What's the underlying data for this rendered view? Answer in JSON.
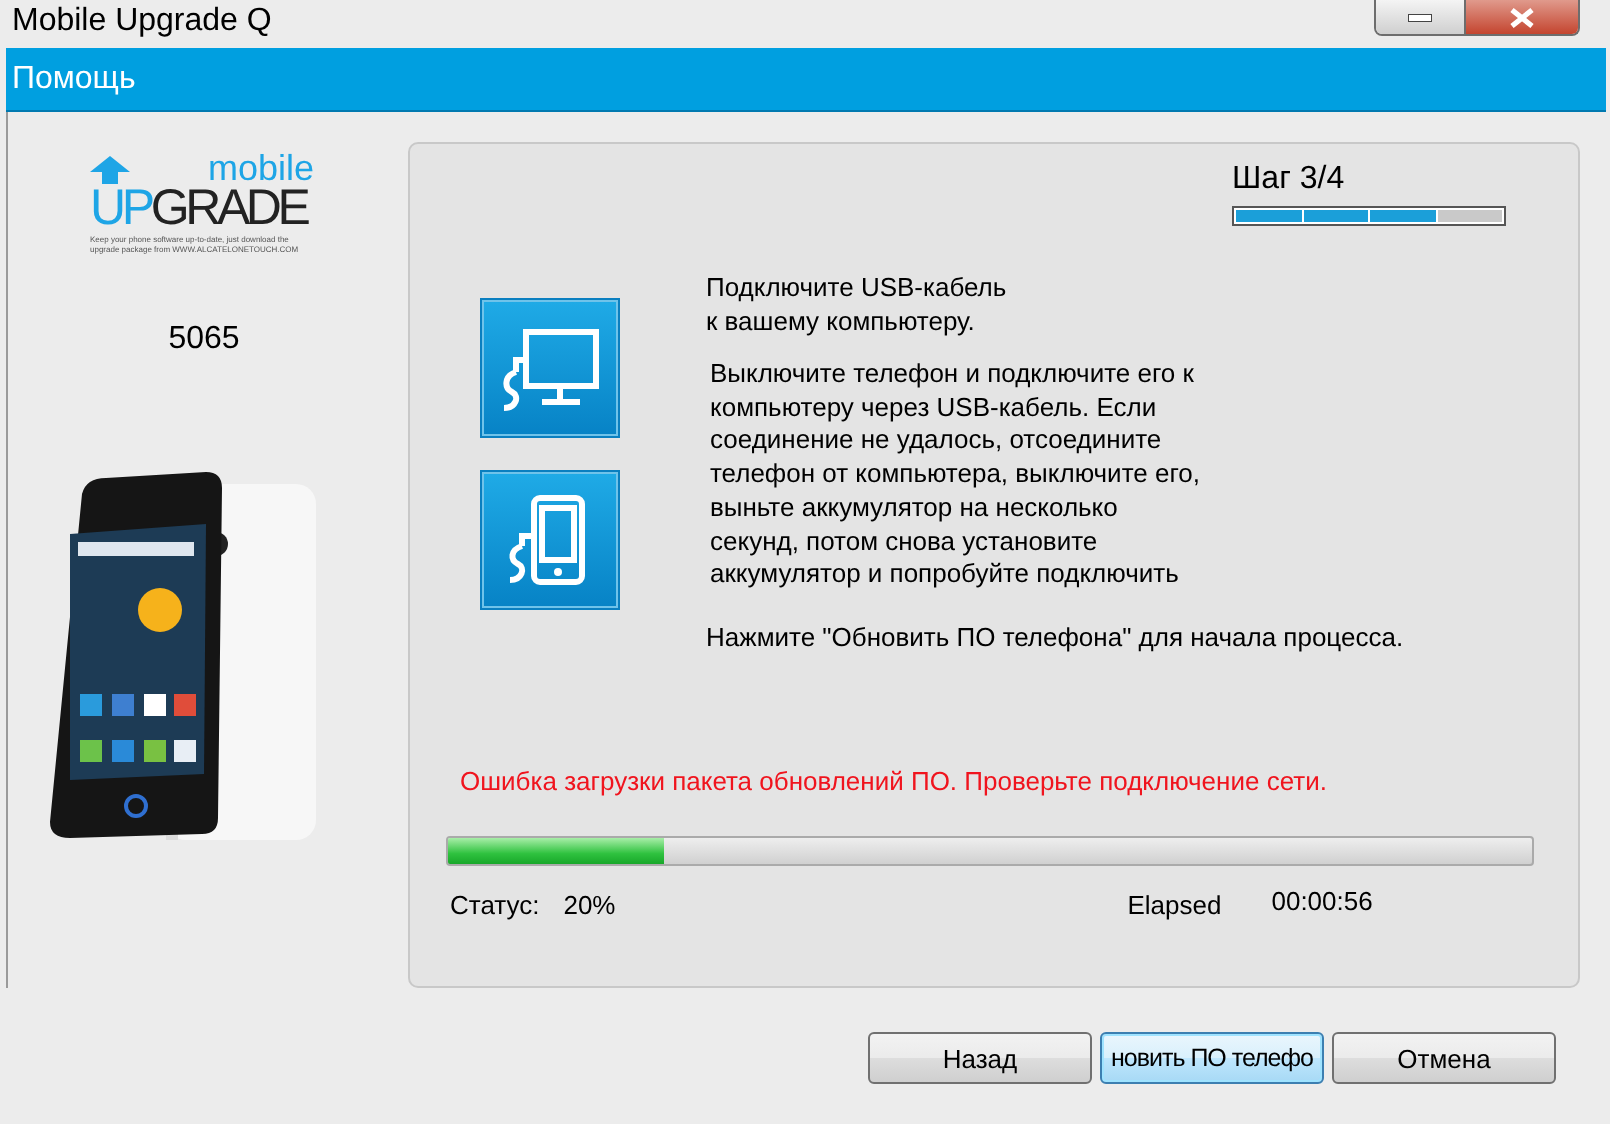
{
  "window": {
    "title": "Mobile Upgrade Q",
    "controls": [
      {
        "kind": "minimize"
      },
      {
        "kind": "close"
      }
    ]
  },
  "menu": [
    "Помощь"
  ],
  "sidebar": {
    "logo": {
      "small": "mobile",
      "up": "UP",
      "grade": "GRADE",
      "tagline": "Keep your phone software up-to-date, just download the upgrade package from WWW.ALCATELONETOUCH.COM"
    },
    "model": "5065"
  },
  "step": {
    "label": "Шаг 3/4",
    "segments": [
      {
        "filled": true
      },
      {
        "filled": true
      },
      {
        "filled": true
      },
      {
        "filled": false
      }
    ]
  },
  "icons": [
    {
      "kind": "monitor"
    },
    {
      "kind": "phone"
    }
  ],
  "instructions": [
    "Подключите USB-кабель\nк вашему компьютеру.",
    "Выключите телефон и  подключите его к\nкомпьютеру через  USB-кабель. Если\nсоединение  не удалось, отсоедините\nтелефон от компьютера, выключите его,\nвыньте  аккумулятор на несколько\nсекунд,  потом снова установите\nаккумулятор  и попробуйте подключить",
    "Нажмите \"Обновить ПО телефона\" для начала процесса."
  ],
  "error": "Ошибка загрузки пакета обновлений ПО. Проверьте подключение сети.",
  "progress": {
    "level": 0.2,
    "status_label": "Статус:",
    "status_value": "20%",
    "elapsed_label": "Elapsed",
    "elapsed_value": "00:00:56"
  },
  "buttons": [
    {
      "label": "Назад",
      "focused": false
    },
    {
      "label": "новить ПО телефо",
      "focused": true
    },
    {
      "label": "Отмена",
      "focused": false
    }
  ]
}
